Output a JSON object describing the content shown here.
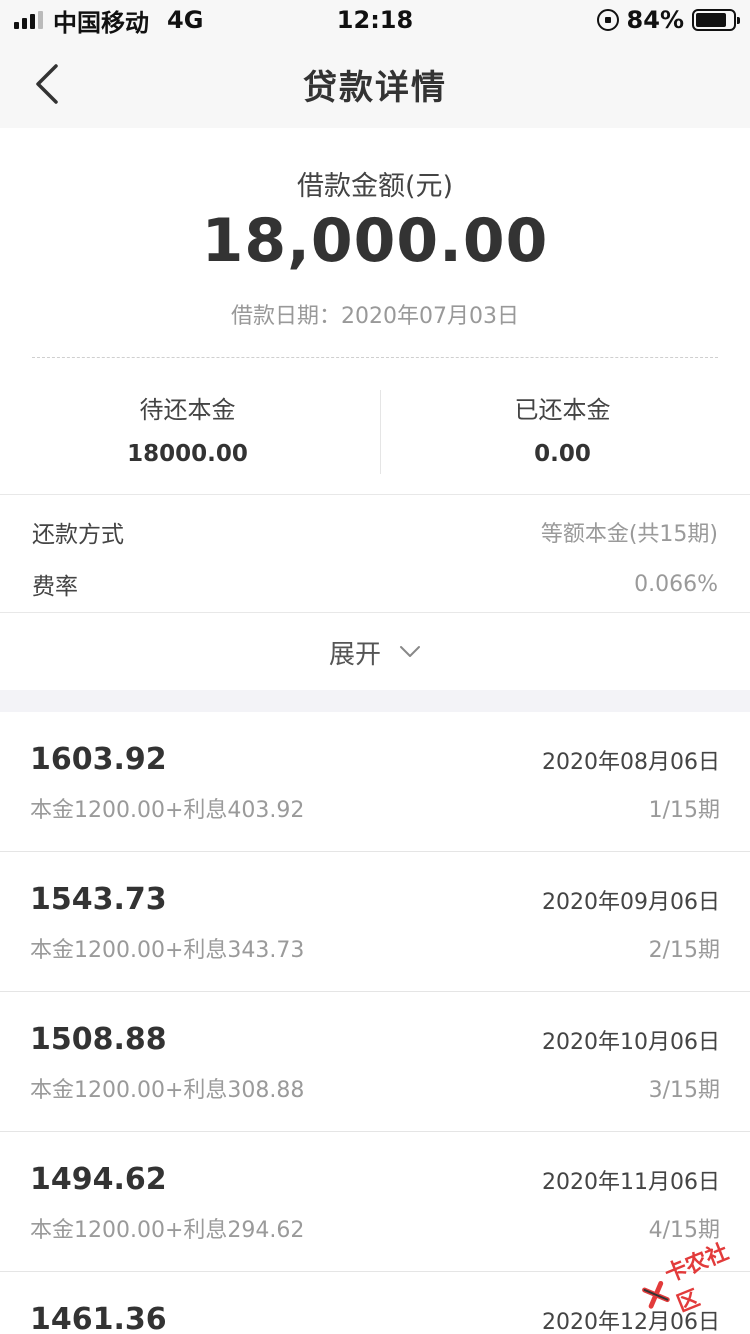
{
  "status_bar": {
    "carrier": "中国移动",
    "network": "4G",
    "time": "12:18",
    "battery": "84%",
    "battery_level": 0.84
  },
  "nav": {
    "title": "贷款详情",
    "back_icon": "chevron-left-icon"
  },
  "summary": {
    "amount_label": "借款金额(元)",
    "amount": "18,000.00",
    "loan_date": "借款日期：2020年07月03日",
    "pending_principal_label": "待还本金",
    "pending_principal": "18000.00",
    "paid_principal_label": "已还本金",
    "paid_principal": "0.00"
  },
  "info": {
    "method_label": "还款方式",
    "method_value": "等额本金(共15期)",
    "rate_label": "费率",
    "rate_value": "0.066%"
  },
  "expand": {
    "label": "展开",
    "icon": "chevron-down-icon"
  },
  "repayments": [
    {
      "amount": "1603.92",
      "date": "2020年08月06日",
      "detail": "本金1200.00+利息403.92",
      "period": "1/15期"
    },
    {
      "amount": "1543.73",
      "date": "2020年09月06日",
      "detail": "本金1200.00+利息343.73",
      "period": "2/15期"
    },
    {
      "amount": "1508.88",
      "date": "2020年10月06日",
      "detail": "本金1200.00+利息308.88",
      "period": "3/15期"
    },
    {
      "amount": "1494.62",
      "date": "2020年11月06日",
      "detail": "本金1200.00+利息294.62",
      "period": "4/15期"
    },
    {
      "amount": "1461.36",
      "date": "2020年12月06日"
    }
  ],
  "watermark": {
    "text": "卡农社区",
    "color": "#e23b3b"
  }
}
